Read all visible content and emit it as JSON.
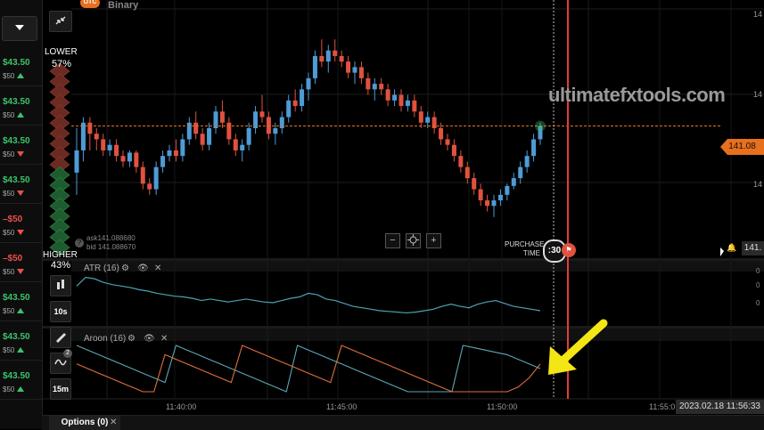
{
  "header": {
    "badge": "OTC",
    "asset": "Binary"
  },
  "left_panel": {
    "rows": [
      {
        "amount": "$43.50",
        "dir": "up",
        "sub": "$50"
      },
      {
        "amount": "$43.50",
        "dir": "up",
        "sub": "$50"
      },
      {
        "amount": "$43.50",
        "dir": "dn",
        "sub": "$50"
      },
      {
        "amount": "$43.50",
        "dir": "dn",
        "sub": "$50"
      },
      {
        "amount": "–$50",
        "dir": "dn",
        "sub": "$50"
      },
      {
        "amount": "–$50",
        "dir": "dn",
        "sub": "$50"
      },
      {
        "amount": "$43.50",
        "dir": "up",
        "sub": "$50"
      },
      {
        "amount": "$43.50",
        "dir": "up",
        "sub": "$50"
      },
      {
        "amount": "$43.50",
        "dir": "up",
        "sub": "$50"
      }
    ]
  },
  "sentiment": {
    "lower_label": "LOWER",
    "lower_pct": "57%",
    "higher_label": "HIGHER",
    "higher_pct": "43%",
    "lower_fraction": 0.57
  },
  "quote": {
    "ask": "ask141.088680",
    "bid": "bid 141.088670",
    "help": "?"
  },
  "watermark": "ultimatefxtools.com",
  "price_tag": "141.08",
  "right_ticks": [
    "14",
    "14",
    "14"
  ],
  "purchase": {
    "label_line1": "PURCHASE",
    "label_line2": "TIME",
    "timer": ":30"
  },
  "mini_tag": "141.",
  "indicators": {
    "atr": {
      "label": "ATR (16)",
      "ticks": [
        "0",
        "0",
        "0"
      ]
    },
    "aroon": {
      "label": "Aroon (16)"
    }
  },
  "tools": {
    "timeframe_1": "10s",
    "timeframe_2": "15m",
    "badge": "2"
  },
  "x_axis": {
    "ticks": [
      "11:40:00",
      "11:45:00",
      "11:50:00",
      "11:55:0"
    ]
  },
  "datetime": "2023.02.18 11:56:33",
  "bottom": {
    "options_tab": "Options (0)",
    "close": "✕"
  },
  "colors": {
    "up_candle": "#4e9bd6",
    "down_candle": "#e0523f",
    "accent": "#e8701c",
    "line_red": "#e33b3b",
    "arrow": "#f4e614"
  },
  "candles": [
    [
      141.04,
      141.08,
      141.02,
      141.06
    ],
    [
      141.06,
      141.09,
      141.05,
      141.085
    ],
    [
      141.085,
      141.09,
      141.06,
      141.075
    ],
    [
      141.075,
      141.08,
      141.06,
      141.07
    ],
    [
      141.07,
      141.075,
      141.055,
      141.06
    ],
    [
      141.06,
      141.07,
      141.055,
      141.065
    ],
    [
      141.065,
      141.07,
      141.05,
      141.055
    ],
    [
      141.055,
      141.06,
      141.045,
      141.05
    ],
    [
      141.05,
      141.06,
      141.045,
      141.058
    ],
    [
      141.058,
      141.06,
      141.04,
      141.045
    ],
    [
      141.045,
      141.05,
      141.025,
      141.03
    ],
    [
      141.03,
      141.035,
      141.02,
      141.025
    ],
    [
      141.025,
      141.05,
      141.02,
      141.045
    ],
    [
      141.045,
      141.06,
      141.04,
      141.055
    ],
    [
      141.055,
      141.065,
      141.05,
      141.06
    ],
    [
      141.06,
      141.07,
      141.05,
      141.055
    ],
    [
      141.055,
      141.075,
      141.05,
      141.07
    ],
    [
      141.07,
      141.09,
      141.065,
      141.085
    ],
    [
      141.085,
      141.095,
      141.07,
      141.075
    ],
    [
      141.075,
      141.08,
      141.06,
      141.065
    ],
    [
      141.065,
      141.085,
      141.06,
      141.08
    ],
    [
      141.08,
      141.1,
      141.075,
      141.095
    ],
    [
      141.095,
      141.105,
      141.08,
      141.085
    ],
    [
      141.085,
      141.09,
      141.065,
      141.07
    ],
    [
      141.07,
      141.075,
      141.055,
      141.06
    ],
    [
      141.06,
      141.07,
      141.05,
      141.065
    ],
    [
      141.065,
      141.085,
      141.06,
      141.08
    ],
    [
      141.08,
      141.1,
      141.075,
      141.095
    ],
    [
      141.095,
      141.11,
      141.085,
      141.09
    ],
    [
      141.09,
      141.095,
      141.07,
      141.075
    ],
    [
      141.075,
      141.085,
      141.065,
      141.08
    ],
    [
      141.08,
      141.095,
      141.075,
      141.09
    ],
    [
      141.09,
      141.11,
      141.085,
      141.105
    ],
    [
      141.105,
      141.115,
      141.095,
      141.1
    ],
    [
      141.1,
      141.12,
      141.095,
      141.115
    ],
    [
      141.115,
      141.13,
      141.105,
      141.125
    ],
    [
      141.125,
      141.15,
      141.12,
      141.145
    ],
    [
      141.145,
      141.16,
      141.135,
      141.14
    ],
    [
      141.14,
      141.155,
      141.13,
      141.15
    ],
    [
      141.15,
      141.16,
      141.14,
      141.145
    ],
    [
      141.145,
      141.15,
      141.135,
      141.14
    ],
    [
      141.14,
      141.145,
      141.125,
      141.13
    ],
    [
      141.13,
      141.14,
      141.12,
      141.135
    ],
    [
      141.135,
      141.14,
      141.12,
      141.125
    ],
    [
      141.125,
      141.13,
      141.11,
      141.115
    ],
    [
      141.115,
      141.125,
      141.105,
      141.12
    ],
    [
      141.12,
      141.125,
      141.11,
      141.115
    ],
    [
      141.115,
      141.12,
      141.1,
      141.105
    ],
    [
      141.105,
      141.115,
      141.1,
      141.11
    ],
    [
      141.11,
      141.115,
      141.095,
      141.1
    ],
    [
      141.1,
      141.11,
      141.095,
      141.105
    ],
    [
      141.105,
      141.11,
      141.09,
      141.095
    ],
    [
      141.095,
      141.1,
      141.08,
      141.085
    ],
    [
      141.085,
      141.095,
      141.08,
      141.09
    ],
    [
      141.09,
      141.095,
      141.075,
      141.08
    ],
    [
      141.08,
      141.085,
      141.065,
      141.07
    ],
    [
      141.07,
      141.075,
      141.06,
      141.065
    ],
    [
      141.065,
      141.07,
      141.05,
      141.055
    ],
    [
      141.055,
      141.06,
      141.04,
      141.045
    ],
    [
      141.045,
      141.05,
      141.03,
      141.035
    ],
    [
      141.035,
      141.04,
      141.02,
      141.025
    ],
    [
      141.025,
      141.03,
      141.01,
      141.015
    ],
    [
      141.015,
      141.02,
      141.005,
      141.01
    ],
    [
      141.01,
      141.02,
      141.0,
      141.015
    ],
    [
      141.015,
      141.025,
      141.01,
      141.02
    ],
    [
      141.02,
      141.03,
      141.015,
      141.028
    ],
    [
      141.028,
      141.04,
      141.025,
      141.035
    ],
    [
      141.035,
      141.05,
      141.03,
      141.045
    ],
    [
      141.045,
      141.06,
      141.04,
      141.055
    ],
    [
      141.055,
      141.075,
      141.05,
      141.07
    ],
    [
      141.07,
      141.085,
      141.065,
      141.082
    ]
  ],
  "atr_values": [
    0.5,
    0.62,
    0.6,
    0.55,
    0.52,
    0.5,
    0.48,
    0.45,
    0.43,
    0.4,
    0.38,
    0.36,
    0.35,
    0.33,
    0.3,
    0.32,
    0.3,
    0.28,
    0.3,
    0.32,
    0.3,
    0.28,
    0.27,
    0.3,
    0.33,
    0.35,
    0.4,
    0.38,
    0.32,
    0.3,
    0.26,
    0.22,
    0.2,
    0.18,
    0.16,
    0.15,
    0.14,
    0.13,
    0.14,
    0.16,
    0.18,
    0.22,
    0.25,
    0.22,
    0.2,
    0.25,
    0.28,
    0.3,
    0.26,
    0.22,
    0.2,
    0.18,
    0.16
  ],
  "aroon_up": [
    1,
    0.9,
    0.8,
    0.7,
    0.6,
    0.5,
    0.4,
    0.3,
    0.2,
    1,
    0.9,
    0.8,
    0.7,
    0.6,
    0.5,
    0.4,
    0.3,
    0.2,
    0.1,
    0,
    1,
    0.9,
    0.8,
    0.7,
    0.6,
    0.5,
    0.4,
    0.3,
    0.2,
    0.1,
    0,
    0,
    0,
    0,
    0,
    1,
    0.95,
    0.9,
    0.85,
    0.8,
    0.7,
    0.6,
    0.5
  ],
  "aroon_down": [
    0.6,
    0.5,
    0.4,
    0.3,
    0.2,
    0.1,
    0,
    0,
    0.8,
    0.7,
    0.6,
    0.5,
    0.4,
    0.3,
    0.2,
    1,
    0.9,
    0.8,
    0.7,
    0.6,
    0.5,
    0.4,
    0.3,
    0.2,
    1,
    0.9,
    0.8,
    0.7,
    0.6,
    0.5,
    0.4,
    0.3,
    0.2,
    0.1,
    0,
    0,
    0,
    0,
    0,
    0,
    0.1,
    0.3,
    0.6
  ]
}
